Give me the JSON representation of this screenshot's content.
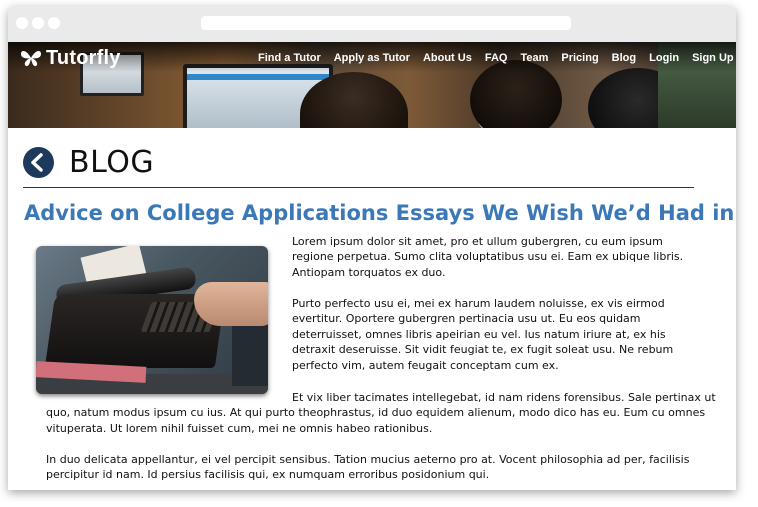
{
  "site": {
    "logo_text": "Tutorfly",
    "nav": [
      "Find a Tutor",
      "Apply as Tutor",
      "About Us",
      "FAQ",
      "Team",
      "Pricing",
      "Blog",
      "Login",
      "Sign Up"
    ]
  },
  "page": {
    "section_title": "BLOG",
    "article_title": "Advice on College Applications Essays We Wish We’d Had in High School",
    "paragraphs": [
      "Lorem ipsum dolor sit amet, pro et ullum gubergren, cu eum ipsum regione perpetua. Sumo clita voluptatibus usu ei. Eam ex ubique libris. Antiopam torquatos ex duo.",
      "Purto perfecto usu ei, mei ex harum laudem noluisse, ex vis eirmod evertitur. Oportere gubergren pertinacia usu ut. Eu eos quidam deterruisset, omnes libris apeirian eu vel. Ius natum iriure at, ex his detraxit deseruisse. Sit vidit feugiat te, ex fugit soleat usu. Ne rebum perfecto vim, autem feugait conceptam cum ex.",
      "Et vix liber tacimates intellegebat, id nam ridens forensibus. Sale pertinax ut quo, natum modus ipsum cu ius. At qui purto theophrastus, id duo equidem alienum, modo dico has eu. Eum cu omnes vituperata. Ut lorem nihil fuisset cum, mei ne omnis habeo rationibus.",
      "In duo delicata appellantur, ei vel percipit sensibus. Tation mucius aeterno pro at. Vocent philosophia ad per, facilisis percipitur id nam. Id persius facilisis qui, ex numquam erroribus posidonium qui."
    ]
  },
  "colors": {
    "accent": "#3b78b8",
    "back_button": "#1d3a5c"
  },
  "icons": {
    "back": "chevron-left-icon",
    "logo": "butterfly-icon"
  }
}
